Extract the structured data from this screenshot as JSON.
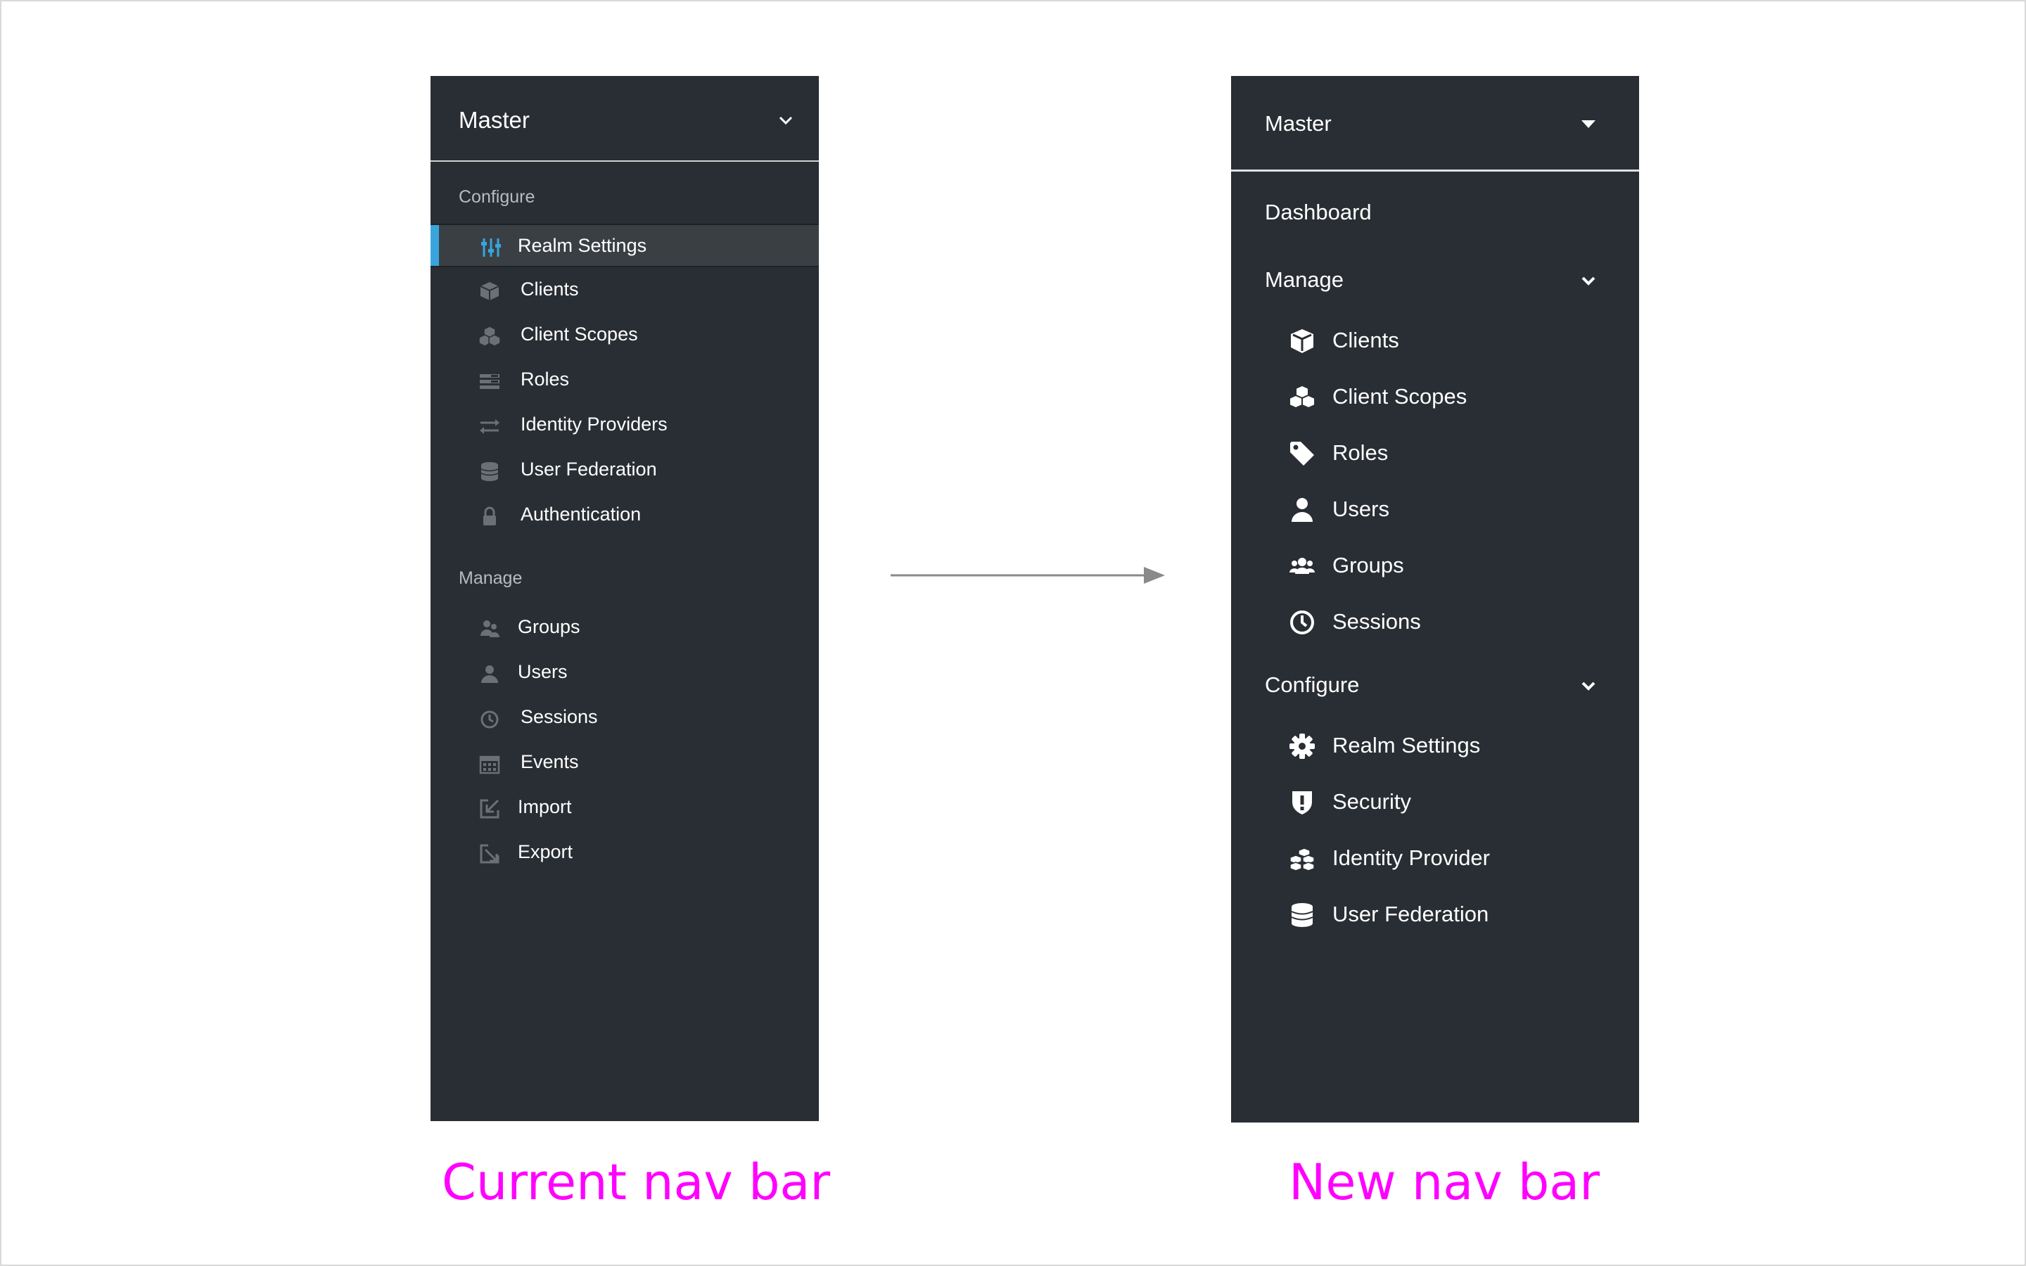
{
  "current_nav": {
    "realm_title": "Master",
    "sections": [
      {
        "label": "Configure",
        "items": [
          {
            "label": "Realm Settings",
            "icon": "sliders-icon",
            "active": true
          },
          {
            "label": "Clients",
            "icon": "cube-icon",
            "active": false
          },
          {
            "label": "Client Scopes",
            "icon": "cubes-icon",
            "active": false
          },
          {
            "label": "Roles",
            "icon": "list-icon",
            "active": false
          },
          {
            "label": "Identity Providers",
            "icon": "exchange-icon",
            "active": false
          },
          {
            "label": "User Federation",
            "icon": "database-icon",
            "active": false
          },
          {
            "label": "Authentication",
            "icon": "lock-icon",
            "active": false
          }
        ]
      },
      {
        "label": "Manage",
        "items": [
          {
            "label": "Groups",
            "icon": "users-icon"
          },
          {
            "label": "Users",
            "icon": "user-icon"
          },
          {
            "label": "Sessions",
            "icon": "clock-icon"
          },
          {
            "label": "Events",
            "icon": "calendar-icon"
          },
          {
            "label": "Import",
            "icon": "import-icon"
          },
          {
            "label": "Export",
            "icon": "export-icon"
          }
        ]
      }
    ],
    "accent_color": "#39a5dc"
  },
  "new_nav": {
    "realm_title": "Master",
    "dashboard_label": "Dashboard",
    "groups": [
      {
        "label": "Manage",
        "items": [
          {
            "label": "Clients",
            "icon": "cube-icon"
          },
          {
            "label": "Client Scopes",
            "icon": "cubes-icon"
          },
          {
            "label": "Roles",
            "icon": "tag-icon"
          },
          {
            "label": "Users",
            "icon": "user-icon"
          },
          {
            "label": "Groups",
            "icon": "users-icon"
          },
          {
            "label": "Sessions",
            "icon": "clock-icon"
          }
        ]
      },
      {
        "label": "Configure",
        "items": [
          {
            "label": "Realm Settings",
            "icon": "gear-icon"
          },
          {
            "label": "Security",
            "icon": "shield-icon"
          },
          {
            "label": "Identity Provider",
            "icon": "cubes-stack-icon"
          },
          {
            "label": "User Federation",
            "icon": "database-icon"
          }
        ]
      }
    ]
  },
  "captions": {
    "current": "Current nav bar",
    "new": "New nav bar"
  },
  "colors": {
    "nav_bg": "#292e34",
    "caption": "#ff00ff"
  }
}
